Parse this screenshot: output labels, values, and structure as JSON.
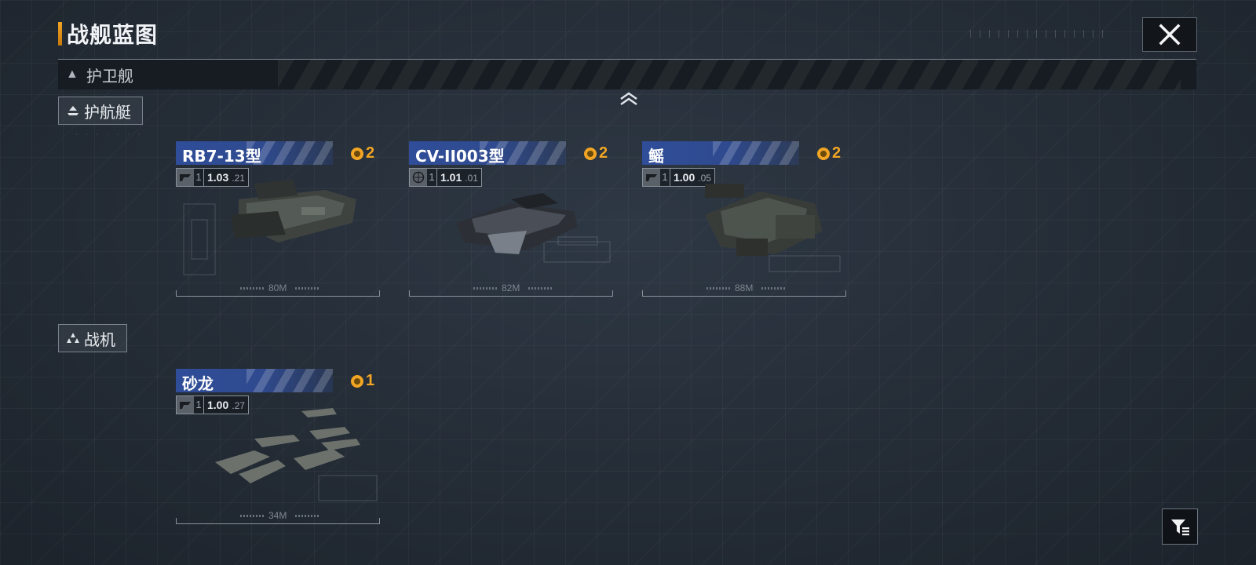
{
  "header": {
    "title": "战舰蓝图",
    "close_icon": "close-icon"
  },
  "category": {
    "label": "护卫舰",
    "expanded": true
  },
  "sections": [
    {
      "label": "护航艇",
      "icon": "escort-boat-icon",
      "cards": [
        {
          "name": "RB7-13型",
          "cost": "2",
          "version_main": "1.03",
          "version_sub": ".21",
          "tier": "1",
          "faction_icon": "faction-emblem-icon",
          "length": "80M"
        },
        {
          "name": "CV-II003型",
          "cost": "2",
          "version_main": "1.01",
          "version_sub": ".01",
          "tier": "1",
          "faction_icon": "globe-icon",
          "length": "82M"
        },
        {
          "name": "鳐",
          "cost": "2",
          "version_main": "1.00",
          "version_sub": ".05",
          "tier": "1",
          "faction_icon": "faction-emblem-icon",
          "length": "88M"
        }
      ]
    },
    {
      "label": "战机",
      "icon": "fighter-icon",
      "cards": [
        {
          "name": "砂龙",
          "cost": "1",
          "version_main": "1.00",
          "version_sub": ".27",
          "tier": "1",
          "faction_icon": "faction-emblem-icon",
          "length": "34M"
        }
      ]
    }
  ],
  "colors": {
    "accent": "#f2a524",
    "card_header": "#2f4d99",
    "background": "#242c36"
  },
  "filter_icon": "filter-icon"
}
